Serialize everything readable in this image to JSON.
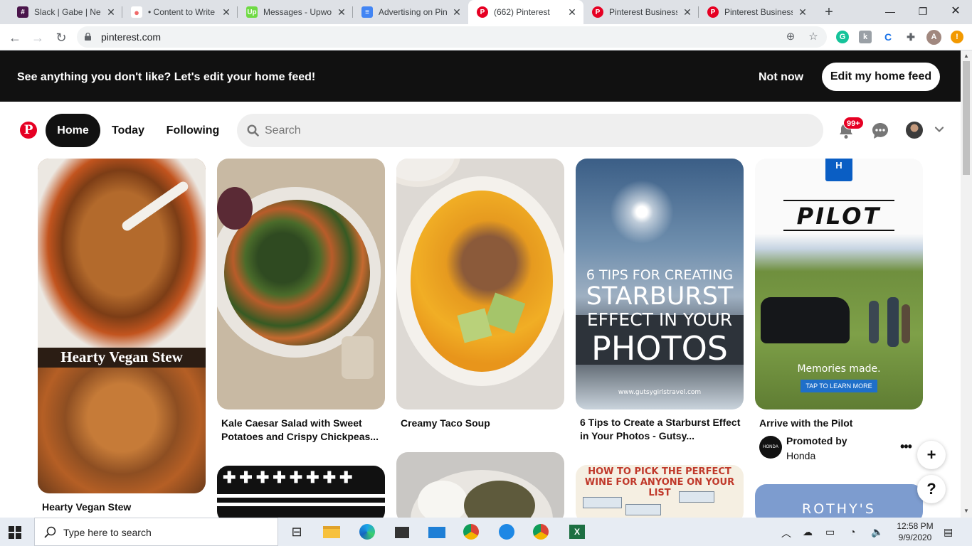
{
  "browser": {
    "tabs": [
      {
        "title": "Slack | Gabe | Nels",
        "color": "#4a154b",
        "active": false
      },
      {
        "title": "• Content to Write",
        "color": "#f06a6a",
        "active": false
      },
      {
        "title": "Messages - Upwor",
        "color": "#6fda44",
        "active": false
      },
      {
        "title": "Advertising on Pin",
        "color": "#4285f4",
        "active": false
      },
      {
        "title": "(662) Pinterest",
        "color": "#e60023",
        "active": true
      },
      {
        "title": "Pinterest Business",
        "color": "#e60023",
        "active": false
      },
      {
        "title": "Pinterest Business",
        "color": "#e60023",
        "active": false
      }
    ],
    "url": "pinterest.com"
  },
  "banner": {
    "message": "See anything you don't like? Let's edit your home feed!",
    "not_now": "Not now",
    "edit_feed": "Edit my home feed"
  },
  "header": {
    "logo_letter": "P",
    "nav": [
      "Home",
      "Today",
      "Following"
    ],
    "search_placeholder": "Search",
    "notification_count": "99+"
  },
  "pins": [
    {
      "title": "Hearty Vegan Stew",
      "overlay": "Hearty Vegan Stew"
    },
    {
      "title_line1": "Kale Caesar Salad with Sweet",
      "title_line2": "Potatoes and Crispy Chickpeas..."
    },
    {
      "title": "Creamy Taco Soup"
    },
    {
      "title_line1": "6 Tips to Create a Starburst Effect",
      "title_line2": "in Your Photos - Gutsy...",
      "overlay1": "6 TIPS FOR CREATING",
      "overlay2": "STARBURST",
      "overlay3": "EFFECT IN YOUR",
      "overlay4": "PHOTOS",
      "watermark": "www.gutsygirlstravel.com"
    },
    {
      "title": "Arrive with the Pilot",
      "brand": "PILOT",
      "tagline": "Memories made.",
      "cta": "TAP TO LEARN MORE",
      "promoted_by": "Promoted by",
      "advertiser": "Honda",
      "logo_text": "HONDA"
    }
  ],
  "lower_pins": {
    "wine_title1": "HOW TO PICK THE PERFECT",
    "wine_title2": "WINE FOR ANYONE ON YOUR LIST",
    "rothys": "ROTHY'S"
  },
  "fab": {
    "add": "+",
    "help": "?"
  },
  "taskbar": {
    "search_text": "Type here to search",
    "time": "12:58 PM",
    "date": "9/9/2020"
  }
}
